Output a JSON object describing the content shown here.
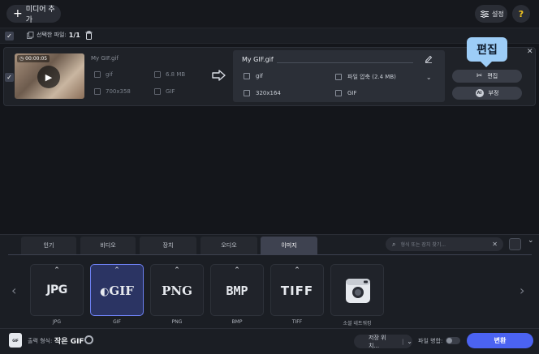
{
  "toolbar": {
    "add_media_label": "미디어 추가",
    "settings_label": "설정",
    "help_label": "?"
  },
  "selection": {
    "label": "선택한 파일:",
    "count": "1/1"
  },
  "file": {
    "duration": "00:00:05",
    "source_name": "My GIF.gif",
    "source_format": "gif",
    "source_size": "6.8 MB",
    "source_resolution": "700x358",
    "source_codec": "GIF",
    "output_name": "My GIF.gif",
    "output_format": "gif",
    "output_size": "파일 압축 (2.4 MB)",
    "output_resolution": "320x164",
    "output_codec": "GIF",
    "edit_label": "편집",
    "ai_label": "부정",
    "ai_badge": "AI",
    "tooltip": "편집"
  },
  "tabs": [
    {
      "label": "인기"
    },
    {
      "label": "비디오"
    },
    {
      "label": "장치"
    },
    {
      "label": "오디오"
    },
    {
      "label": "이미지",
      "active": true
    }
  ],
  "search": {
    "placeholder": "형식 또는 장치 찾기..."
  },
  "presets": [
    {
      "logo": "JPG",
      "label": "JPG"
    },
    {
      "logo": "GIF",
      "label": "GIF",
      "active": true
    },
    {
      "logo": "PNG",
      "label": "PNG"
    },
    {
      "logo": "BMP",
      "label": "BMP"
    },
    {
      "logo": "TIFF",
      "label": "TIFF"
    },
    {
      "logo": "camera-icon",
      "label": "소셜 네트워킹"
    }
  ],
  "footer": {
    "format_icon": "GIF",
    "output_format_label": "출력 형식:",
    "output_format_value": "작은 GIF",
    "save_to_label": "저장 위치...",
    "merge_label": "파일 병합:",
    "convert_label": "변환"
  },
  "colors": {
    "accent": "#4b63f2",
    "tooltip": "#9dcdf7",
    "active_preset": "#2b3463"
  }
}
